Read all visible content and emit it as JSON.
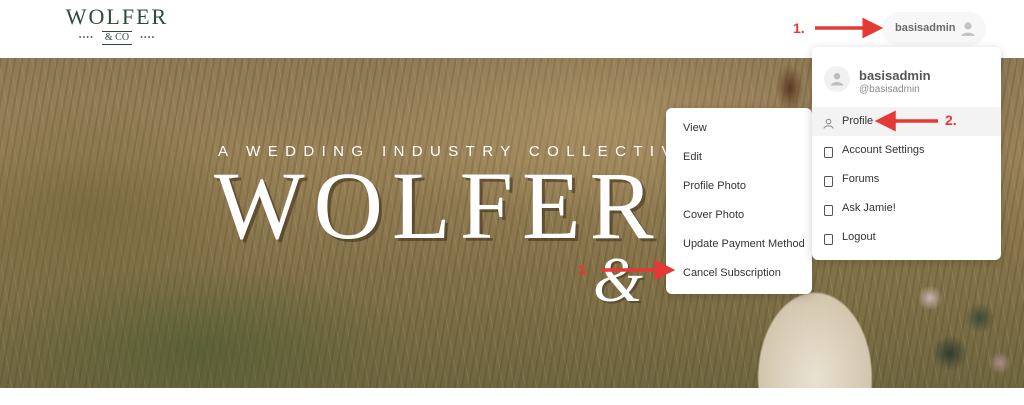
{
  "brand": {
    "name": "WOLFER",
    "sub": "& CO",
    "dots": "••••"
  },
  "header": {
    "username": "basisadmin",
    "avatar_icon": "user-avatar-icon"
  },
  "hero": {
    "tagline": "A WEDDING INDUSTRY COLLECTIVE",
    "title": "WOLFER",
    "ampersand": "&"
  },
  "account_menu": {
    "display_name": "basisadmin",
    "handle": "@basisadmin",
    "items": [
      {
        "label": "Profile",
        "icon": "user-icon",
        "active": true
      },
      {
        "label": "Account Settings",
        "icon": "page-icon"
      },
      {
        "label": "Forums",
        "icon": "page-icon"
      },
      {
        "label": "Ask Jamie!",
        "icon": "page-icon"
      },
      {
        "label": "Logout",
        "icon": "page-icon"
      }
    ]
  },
  "profile_menu": {
    "items": [
      {
        "label": "View"
      },
      {
        "label": "Edit"
      },
      {
        "label": "Profile Photo"
      },
      {
        "label": "Cover Photo"
      },
      {
        "label": "Update Payment Method"
      },
      {
        "label": "Cancel Subscription"
      }
    ]
  },
  "annotations": {
    "step1": "1.",
    "step2": "2.",
    "step3": "3.",
    "color": "#e53935"
  }
}
